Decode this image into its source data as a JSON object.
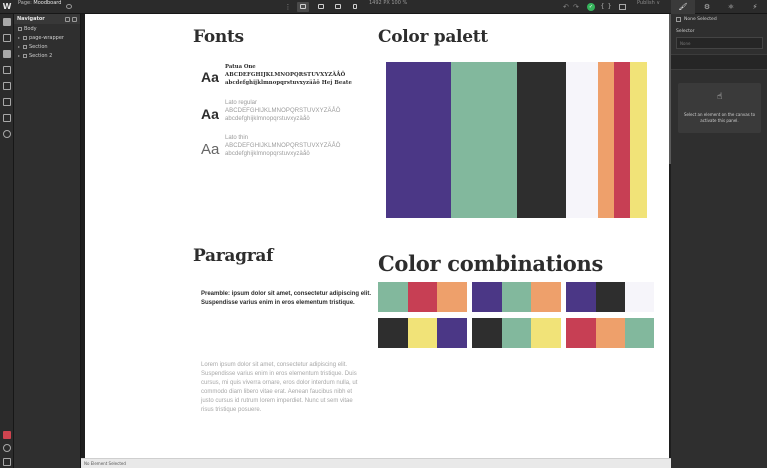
{
  "topbar": {
    "logo": "W",
    "page_prefix": "Page:",
    "page_name": "Moodboard",
    "dots": "⋮",
    "dimensions": "1492 PX  100 %",
    "undo": "↶",
    "redo": "↷",
    "ok": "✓",
    "code": "{ }",
    "publish": "Publish ∨",
    "right_tabs": [
      "🖌",
      "⚙",
      "⚛",
      "⚡"
    ]
  },
  "navigator": {
    "title": "Navigator",
    "items": [
      {
        "label": "Body",
        "has_arrow": false
      },
      {
        "label": "page-wrapper",
        "has_arrow": true
      },
      {
        "label": "Section",
        "has_arrow": true
      },
      {
        "label": "Section 2",
        "has_arrow": true
      }
    ]
  },
  "canvas": {
    "fonts_title": "Fonts",
    "palette_title": "Color palett",
    "paragraf_title": "Paragraf",
    "combos_title": "Color combinations",
    "fonts": [
      {
        "aa": "Aa",
        "name": "Patua One",
        "line1": "ABCDEFGHIJKLMNOPQRSTUVXYZÄÅÖ",
        "line2": "abcdefghijklmnopqrstuvxyzäåö Hej Beate"
      },
      {
        "aa": "Aa",
        "name": "Lato regular",
        "line1": "ABCDEFGHIJKLMNOPQRSTUVXYZÄÅÖ",
        "line2": "abcdefghijklmnopqrstuvxyzäåö"
      },
      {
        "aa": "Aa",
        "name": "Lato thin",
        "line1": "ABCDEFGHIJKLMNOPQRSTUVXYZÄÅÖ",
        "line2": "abcdefghijklmnopqrstuvxyzäåö"
      }
    ],
    "palette": [
      "#4b3786",
      "#82b89d",
      "#2e2e2e",
      "#f6f5fa",
      "#eea06b",
      "#c73f54",
      "#f1e378"
    ],
    "preamble": "Preamble: ipsum dolor sit amet, consectetur adipiscing elit. Suspendisse varius enim in eros elementum tristique.",
    "lorem": "Lorem ipsum dolor sit amet, consectetur adipiscing elit. Suspendisse varius enim in eros elementum tristique. Duis cursus, mi quis viverra ornare, eros dolor interdum nulla, ut commodo diam libero vitae erat. Aenean faucibus nibh et justo cursus id rutrum lorem imperdiet. Nunc ut sem vitae risus tristique posuere.",
    "combos": [
      [
        "#82b89d",
        "#c73f54",
        "#eea06b"
      ],
      [
        "#4b3786",
        "#82b89d",
        "#eea06b"
      ],
      [
        "#4b3786",
        "#2e2e2e",
        "#f6f5fa"
      ],
      [
        "#2e2e2e",
        "#f1e378",
        "#4b3786"
      ],
      [
        "#2e2e2e",
        "#82b89d",
        "#f1e378"
      ],
      [
        "#c73f54",
        "#eea06b",
        "#82b89d"
      ]
    ]
  },
  "status": {
    "text": "No Element Selected"
  },
  "right_panel": {
    "none_selected": "None Selected",
    "selector_label": "Selector",
    "selector_placeholder": "None",
    "hand": "☝",
    "message": "Select an element on the canvas to activate this panel."
  }
}
